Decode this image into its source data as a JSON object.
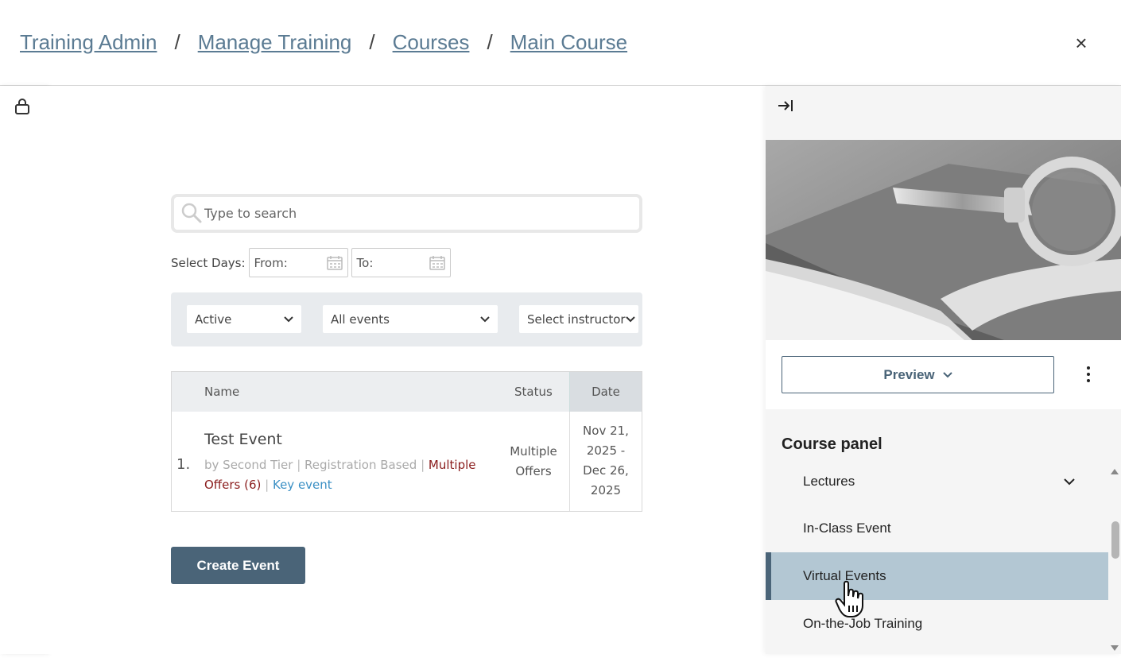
{
  "breadcrumb": {
    "items": [
      {
        "label": "Training Admin"
      },
      {
        "label": "Manage Training"
      },
      {
        "label": "Courses"
      },
      {
        "label": "Main Course"
      }
    ],
    "separator": "/"
  },
  "header": {
    "close_label": "×"
  },
  "search": {
    "placeholder": "Type to search",
    "value": ""
  },
  "date_filter": {
    "label": "Select Days:",
    "from_placeholder": "From:",
    "to_placeholder": "To:"
  },
  "filters": {
    "status": "Active",
    "events": "All events",
    "instructor": "Select instructor"
  },
  "table": {
    "headers": {
      "name": "Name",
      "status": "Status",
      "date": "Date"
    },
    "rows": [
      {
        "index": "1.",
        "title": "Test Event",
        "by": "by Second Tier",
        "type": "Registration Based",
        "offers": "Multiple Offers (6)",
        "key": "Key event",
        "status_line1": "Multiple",
        "status_line2": "Offers",
        "date_line1": "Nov 21,",
        "date_line2": "2025 -",
        "date_line3": "Dec 26,",
        "date_line4": "2025"
      }
    ]
  },
  "create_button": "Create Event",
  "right_panel": {
    "preview_label": "Preview",
    "course_panel_title": "Course panel",
    "items": [
      {
        "label": "Lectures",
        "expandable": true
      },
      {
        "label": "In-Class Event"
      },
      {
        "label": "Virtual Events",
        "active": true
      },
      {
        "label": "On-the-Job Training"
      }
    ]
  },
  "colors": {
    "accent": "#4a6478",
    "breadcrumb": "#5b7b93",
    "active_item": "#b3c7d3",
    "offers_red": "#8a1c1c",
    "key_blue": "#3a8fc4"
  },
  "icons": [
    "lock-icon",
    "search-icon",
    "calendar-icon",
    "chevron-down-icon",
    "collapse-panel-icon",
    "kebab-menu-icon",
    "close-icon",
    "hand-cursor-icon"
  ]
}
